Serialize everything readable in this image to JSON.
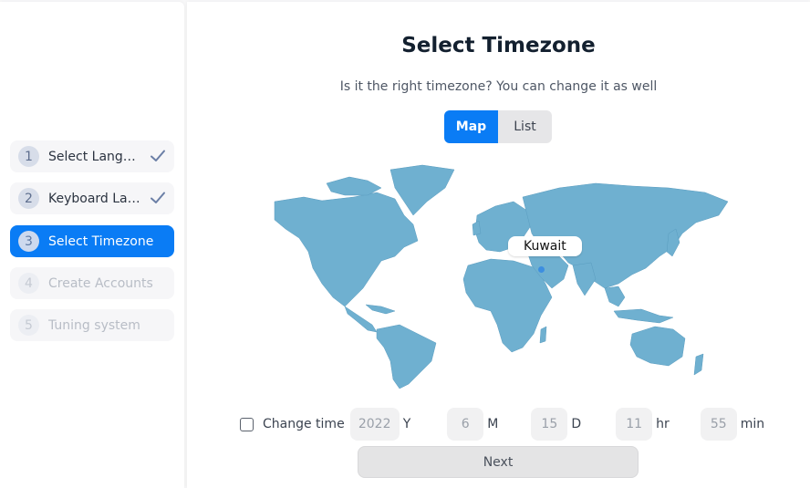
{
  "sidebar": {
    "steps": [
      {
        "number": "1",
        "label": "Select Language",
        "state": "done"
      },
      {
        "number": "2",
        "label": "Keyboard Layout",
        "state": "done"
      },
      {
        "number": "3",
        "label": "Select Timezone",
        "state": "active"
      },
      {
        "number": "4",
        "label": "Create Accounts",
        "state": "disabled"
      },
      {
        "number": "5",
        "label": "Tuning system",
        "state": "disabled"
      }
    ]
  },
  "main": {
    "title": "Select Timezone",
    "subtitle": "Is it the right timezone? You can change it as well",
    "view_toggle": {
      "map_label": "Map",
      "list_label": "List",
      "selected": "Map"
    },
    "map": {
      "selected_region": "Kuwait",
      "land_color": "#6fb0d0",
      "marker_color": "#3d8ee0"
    },
    "time": {
      "checkbox_label": "Change time",
      "checked": false,
      "year": "2022",
      "year_unit": "Y",
      "month": "6",
      "month_unit": "M",
      "day": "15",
      "day_unit": "D",
      "hour": "11",
      "hour_unit": "hr",
      "minute": "55",
      "minute_unit": "min"
    },
    "next_label": "Next"
  },
  "colors": {
    "accent": "#0a7cf5"
  }
}
